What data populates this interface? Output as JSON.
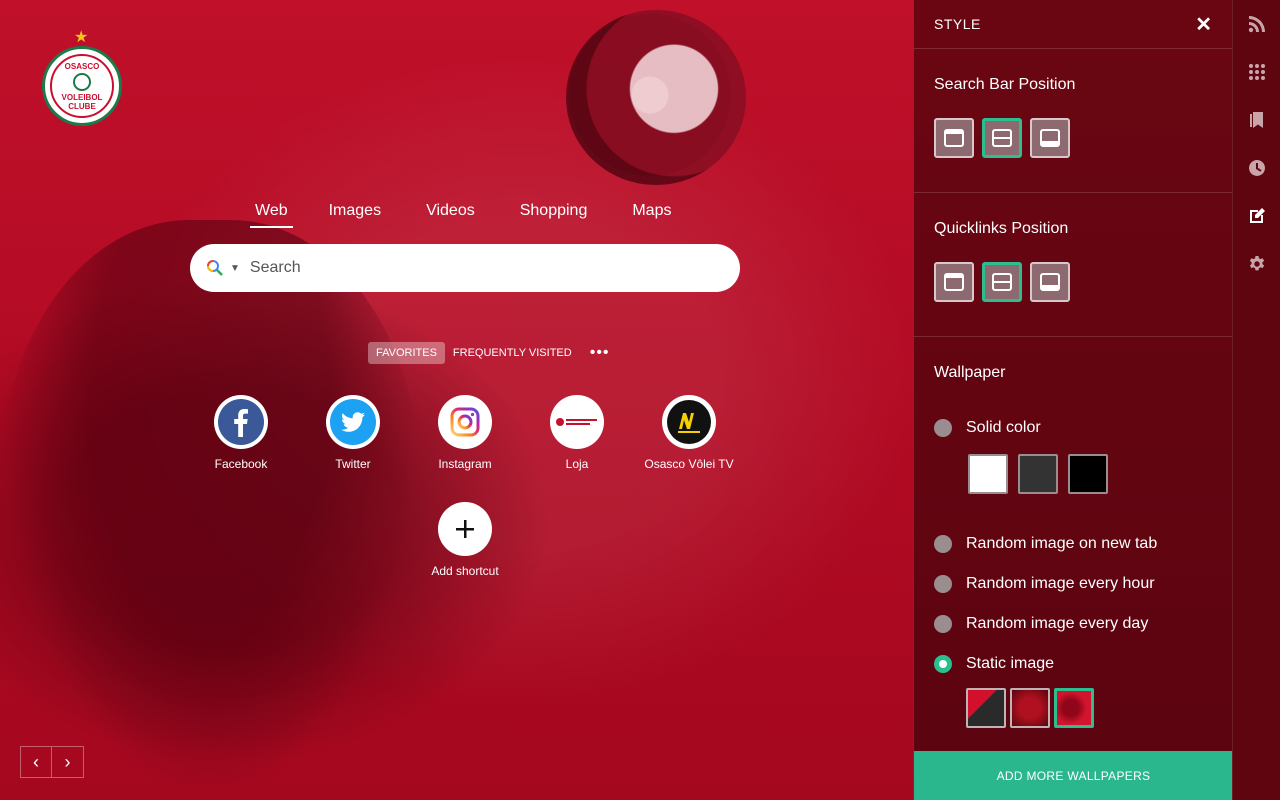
{
  "logo": {
    "top_text": "OSASCO",
    "mid_text": "VOLEIBOL",
    "bottom_text": "CLUBE"
  },
  "search": {
    "tabs": [
      {
        "label": "Web",
        "active": true
      },
      {
        "label": "Images",
        "active": false
      },
      {
        "label": "Videos",
        "active": false
      },
      {
        "label": "Shopping",
        "active": false
      },
      {
        "label": "Maps",
        "active": false
      }
    ],
    "placeholder": "Search",
    "engine_icon": "multicolor-search-icon"
  },
  "quicklinks": {
    "tabs": [
      {
        "label": "FAVORITES",
        "active": true
      },
      {
        "label": "FREQUENTLY VISITED",
        "active": false
      }
    ],
    "more_icon": "more-horizontal-icon",
    "items": [
      {
        "label": "Facebook",
        "icon": "facebook-icon"
      },
      {
        "label": "Twitter",
        "icon": "twitter-icon"
      },
      {
        "label": "Instagram",
        "icon": "instagram-icon"
      },
      {
        "label": "Loja",
        "icon": "loja-logo-icon"
      },
      {
        "label": "Osasco Vôlei TV",
        "icon": "sports-tv-icon"
      },
      {
        "label": "Add shortcut",
        "icon": "plus-icon"
      }
    ]
  },
  "panel": {
    "title": "STYLE",
    "search_bar_position": {
      "title": "Search Bar Position",
      "options": [
        "top",
        "middle",
        "bottom"
      ],
      "selected": "middle"
    },
    "quicklinks_position": {
      "title": "Quicklinks Position",
      "options": [
        "top",
        "middle",
        "bottom"
      ],
      "selected": "middle"
    },
    "wallpaper": {
      "title": "Wallpaper",
      "options": [
        {
          "label": "Solid color",
          "checked": false
        },
        {
          "label": "Random image on new tab",
          "checked": false
        },
        {
          "label": "Random image every hour",
          "checked": false
        },
        {
          "label": "Random image every day",
          "checked": false
        },
        {
          "label": "Static image",
          "checked": true
        }
      ],
      "solid_colors": [
        "#ffffff",
        "#333333",
        "#000000"
      ],
      "accent": "#2bb78e"
    },
    "add_button": "ADD MORE WALLPAPERS"
  },
  "rail": {
    "items": [
      "rss-icon",
      "apps-grid-icon",
      "bookmark-icon",
      "history-clock-icon",
      "edit-style-icon",
      "settings-gear-icon"
    ],
    "active": "edit-style-icon"
  }
}
